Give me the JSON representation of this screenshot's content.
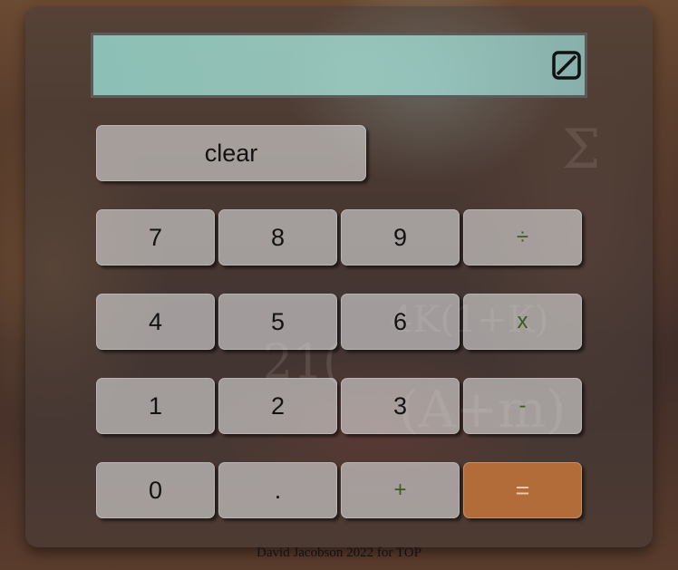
{
  "display": {
    "value": "",
    "backspace_icon": "backspace-icon"
  },
  "buttons": {
    "clear": "clear",
    "seven": "7",
    "eight": "8",
    "nine": "9",
    "divide": "÷",
    "four": "4",
    "five": "5",
    "six": "6",
    "multiply": "x",
    "one": "1",
    "two": "2",
    "three": "3",
    "subtract": "-",
    "zero": "0",
    "decimal": ".",
    "add": "+",
    "equals": "="
  },
  "colors": {
    "display": "#9ed8cf",
    "button": "#dcdcdc",
    "operator_text": "#3d5a1e",
    "equals_button": "#c8783c"
  },
  "footer": "David Jacobson 2022 for TOP"
}
